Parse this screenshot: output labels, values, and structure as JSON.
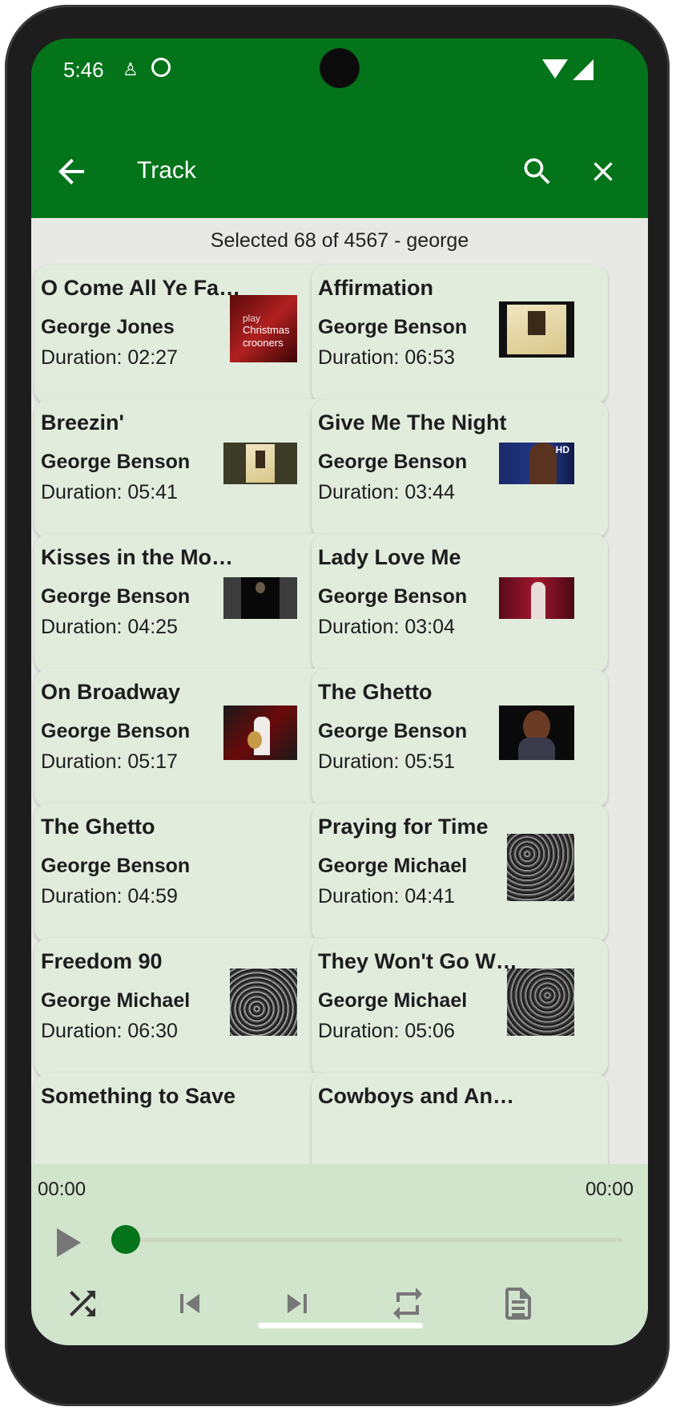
{
  "status_bar": {
    "time": "5:46"
  },
  "app_bar": {
    "title": "Track"
  },
  "summary": "Selected 68 of 4567  - george",
  "tracks": [
    {
      "title": "O Come All Ye Fa…",
      "artist": "George Jones",
      "duration": "Duration: 02:27"
    },
    {
      "title": "Affirmation",
      "artist": "George Benson",
      "duration": "Duration: 06:53"
    },
    {
      "title": "Breezin'",
      "artist": "George Benson",
      "duration": "Duration: 05:41"
    },
    {
      "title": "Give Me The Night",
      "artist": "George Benson",
      "duration": "Duration: 03:44"
    },
    {
      "title": "Kisses in the Mo…",
      "artist": "George Benson",
      "duration": "Duration: 04:25"
    },
    {
      "title": "Lady Love Me",
      "artist": "George Benson",
      "duration": "Duration: 03:04"
    },
    {
      "title": "On Broadway",
      "artist": "George Benson",
      "duration": "Duration: 05:17"
    },
    {
      "title": "The Ghetto",
      "artist": "George Benson",
      "duration": "Duration: 05:51"
    },
    {
      "title": "The Ghetto",
      "artist": "George Benson",
      "duration": "Duration: 04:59"
    },
    {
      "title": "Praying for Time",
      "artist": "George Michael",
      "duration": "Duration: 04:41"
    },
    {
      "title": "Freedom 90",
      "artist": "George Michael",
      "duration": "Duration: 06:30"
    },
    {
      "title": "They Won't Go W…",
      "artist": "George Michael",
      "duration": "Duration: 05:06"
    },
    {
      "title": "Something to Save",
      "artist": "",
      "duration": ""
    },
    {
      "title": "Cowboys and An…",
      "artist": "",
      "duration": ""
    }
  ],
  "thumb_text": {
    "play": "play",
    "christmas": "Christmas",
    "crooners": "crooners",
    "hd": "HD"
  },
  "player": {
    "elapsed": "00:00",
    "total": "00:00",
    "progress": 0
  },
  "colors": {
    "primary": "#03741a",
    "card": "#e1ecdd",
    "player": "#d1e4cc",
    "background": "#e8e9e6"
  }
}
